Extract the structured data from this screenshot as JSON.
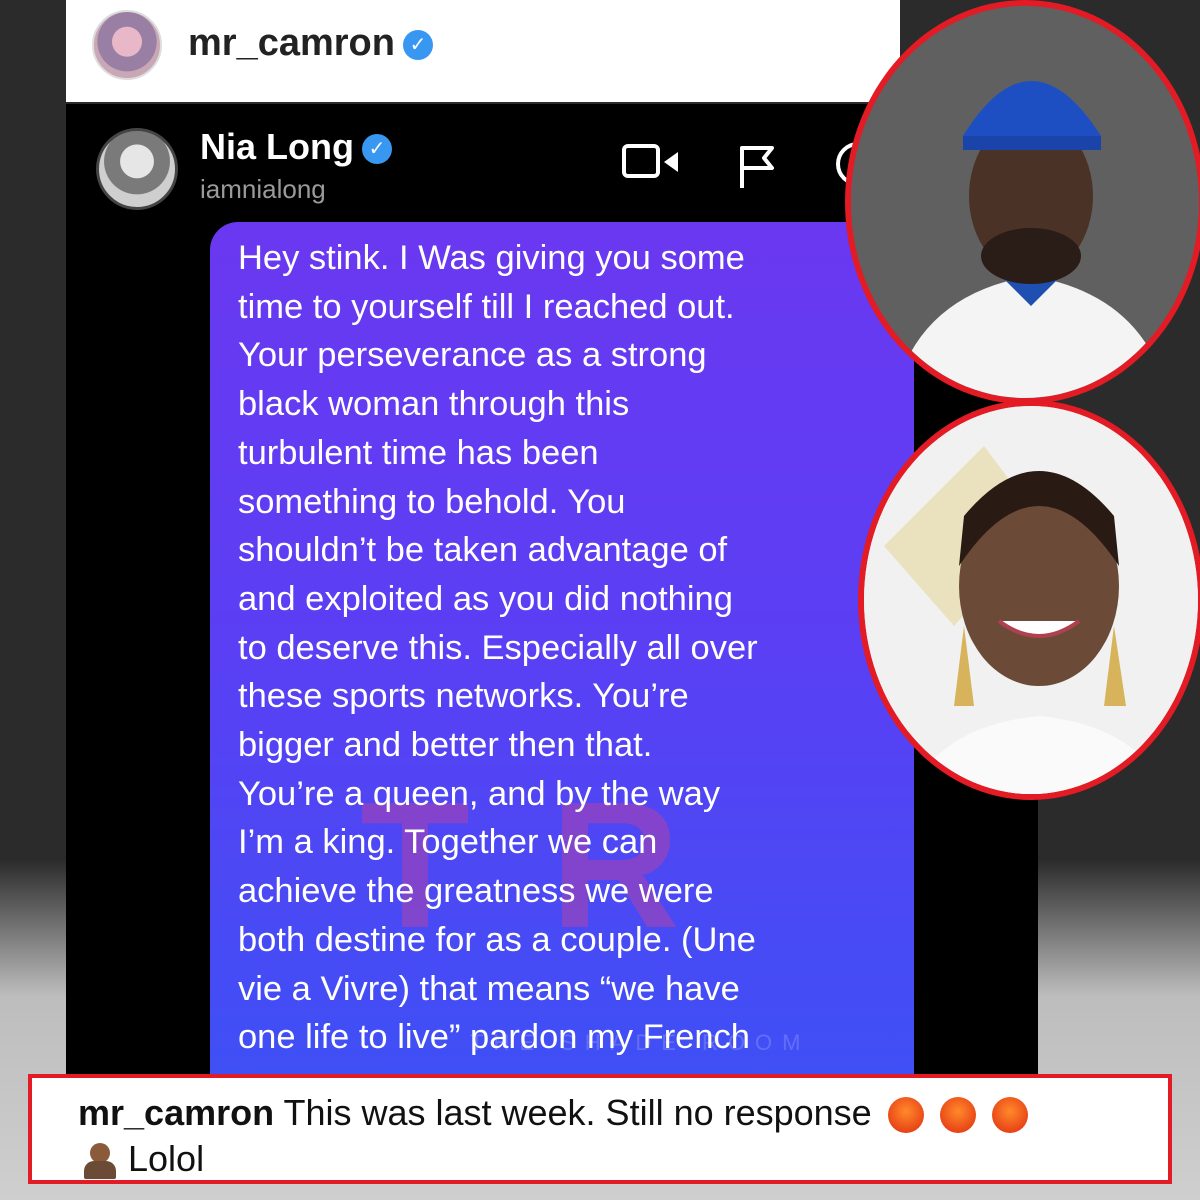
{
  "post": {
    "username": "mr_camron",
    "verified": true,
    "icons": [
      "verified-badge-icon"
    ]
  },
  "dm": {
    "contact_name": "Nia Long",
    "contact_handle": "iamnialong",
    "icons": [
      "video-call-icon",
      "report-flag-icon",
      "info-icon"
    ],
    "message": "Hey stink. I Was giving you some\ntime to yourself till I reached out.\nYour perseverance as a strong\nblack woman through this\nturbulent time has been\nsomething to behold. You\nshouldn’t  be taken advantage of\nand exploited as you did nothing\nto deserve this. Especially all over\nthese sports networks. You’re\nbigger and better then that.\nYou’re a queen, and by the way\nI’m a king. Together we can\nachieve the greatness we were\nboth destine for as a couple. (Une\nvie a Vivre) that means “we have\none life to live” pardon my French",
    "watermark_letters": "TR",
    "watermark_text": "THE SHADE ROOM"
  },
  "caption": {
    "username": "mr_camron",
    "text": "This was last week. Still no response",
    "second_line": "Lolol",
    "emojis": [
      "angry-face-icon",
      "angry-face-icon",
      "angry-face-icon",
      "person-shrugging-icon"
    ]
  },
  "colors": {
    "highlight_border": "#e21b24",
    "bubble_top": "#6a38f0",
    "bubble_bottom": "#3f50f5",
    "verified": "#3897f0"
  }
}
